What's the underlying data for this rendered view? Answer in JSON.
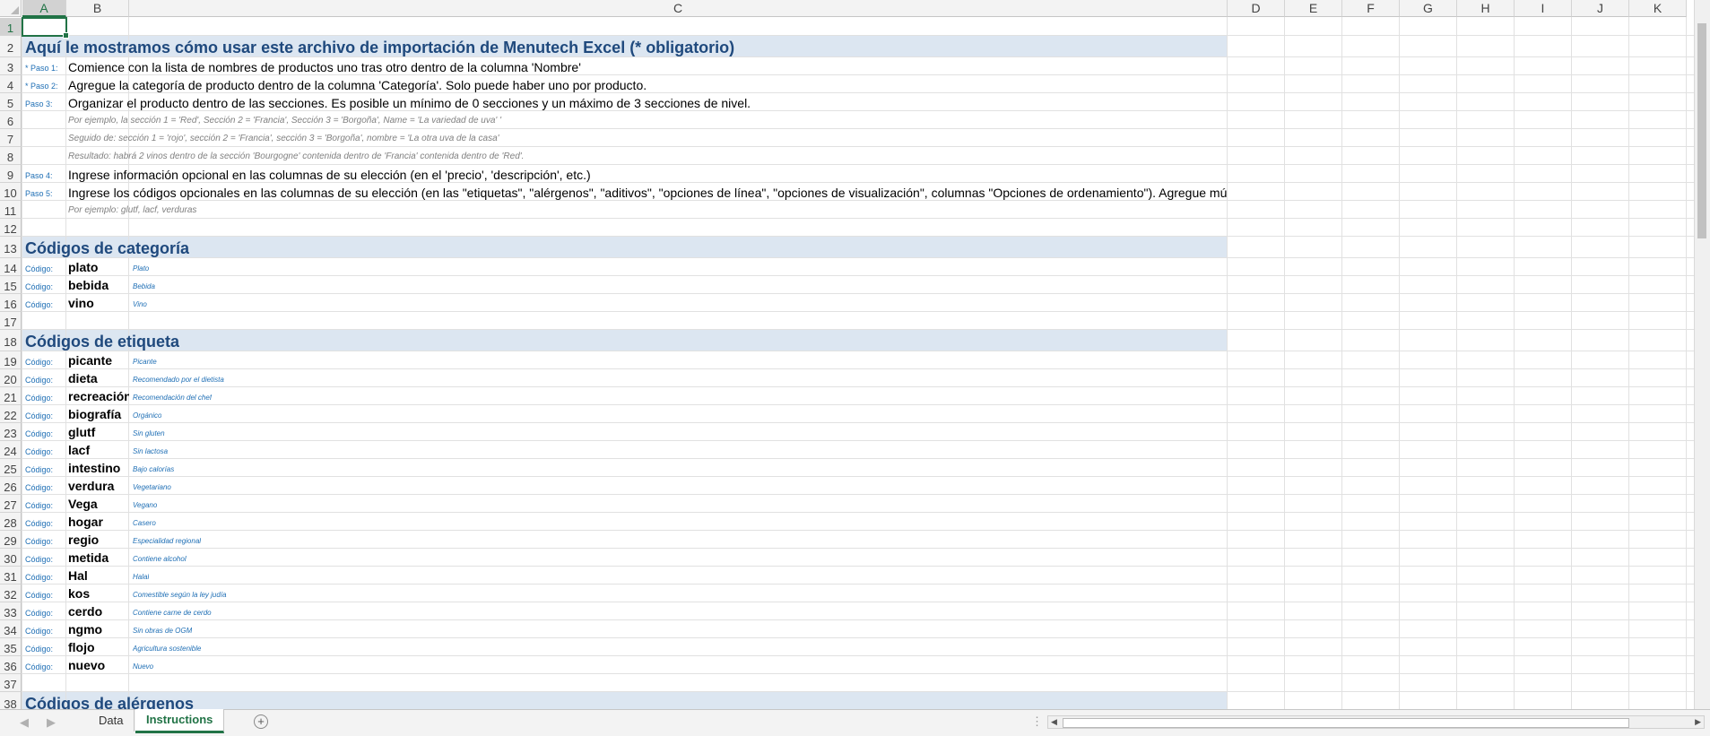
{
  "columns": [
    "A",
    "B",
    "C",
    "D",
    "E",
    "F",
    "G",
    "H",
    "I",
    "J",
    "K"
  ],
  "selected_cell": "A1",
  "rows": [
    {
      "n": "1",
      "type": "empty"
    },
    {
      "n": "2",
      "type": "title",
      "c1": "Aquí le mostramos cómo usar este archivo de importación de Menutech Excel (* obligatorio)"
    },
    {
      "n": "3",
      "type": "step",
      "a": "* Paso 1:",
      "b": "Comience con la lista de nombres de productos uno tras otro dentro de la columna 'Nombre'"
    },
    {
      "n": "4",
      "type": "step",
      "a": "* Paso 2:",
      "b": "Agregue la categoría de producto dentro de la columna 'Categoría'. Solo puede haber uno por producto."
    },
    {
      "n": "5",
      "type": "step",
      "a": "Paso 3:",
      "b": "Organizar el producto dentro de las secciones. Es posible un mínimo de 0 secciones y un máximo de 3 secciones de nivel."
    },
    {
      "n": "6",
      "type": "example",
      "b": "Por ejemplo, la sección 1 = 'Red', Sección 2 = 'Francia', Sección 3 = 'Borgoña', Name = 'La variedad de uva' '"
    },
    {
      "n": "7",
      "type": "example",
      "b": "Seguido de: sección 1 = 'rojo', sección 2 = 'Francia', sección 3 = 'Borgoña', nombre = 'La otra uva de la casa'"
    },
    {
      "n": "8",
      "type": "example",
      "b": "Resultado: habrá 2 vinos dentro de la sección 'Bourgogne' contenida dentro de 'Francia' contenida dentro de 'Red'."
    },
    {
      "n": "9",
      "type": "step",
      "a": "Paso 4:",
      "b": "Ingrese información opcional en las columnas de su elección (en el 'precio', 'descripción', etc.)"
    },
    {
      "n": "10",
      "type": "step",
      "a": "Paso 5:",
      "b": "Ingrese los códigos opcionales en las columnas de su elección (en las \"etiquetas\", \"alérgenos\", \"aditivos\", \"opciones de línea\", \"opciones de visualización\", columnas \"Opciones de ordenamiento\"). Agregue múltiples códigos separados por comas."
    },
    {
      "n": "11",
      "type": "example",
      "b": "Por ejemplo: glutf, lacf, verduras"
    },
    {
      "n": "12",
      "type": "empty"
    },
    {
      "n": "13",
      "type": "title",
      "c1": "Códigos de categoría"
    },
    {
      "n": "14",
      "type": "code",
      "a": "Código:",
      "b": "plato",
      "c": "Plato"
    },
    {
      "n": "15",
      "type": "code",
      "a": "Código:",
      "b": "bebida",
      "c": "Bebida"
    },
    {
      "n": "16",
      "type": "code",
      "a": "Código:",
      "b": "vino",
      "c": "Vino"
    },
    {
      "n": "17",
      "type": "empty"
    },
    {
      "n": "18",
      "type": "title",
      "c1": "Códigos de etiqueta"
    },
    {
      "n": "19",
      "type": "code",
      "a": "Código:",
      "b": "picante",
      "c": "Picante"
    },
    {
      "n": "20",
      "type": "code",
      "a": "Código:",
      "b": "dieta",
      "c": "Recomendado por el dietista"
    },
    {
      "n": "21",
      "type": "code",
      "a": "Código:",
      "b": "recreación",
      "c": "Recomendación del chef"
    },
    {
      "n": "22",
      "type": "code",
      "a": "Código:",
      "b": "biografía",
      "c": "Orgánico"
    },
    {
      "n": "23",
      "type": "code",
      "a": "Código:",
      "b": "glutf",
      "c": "Sin gluten"
    },
    {
      "n": "24",
      "type": "code",
      "a": "Código:",
      "b": "lacf",
      "c": "Sin lactosa"
    },
    {
      "n": "25",
      "type": "code",
      "a": "Código:",
      "b": "intestino",
      "c": "Bajo calorías"
    },
    {
      "n": "26",
      "type": "code",
      "a": "Código:",
      "b": "verdura",
      "c": "Vegetariano"
    },
    {
      "n": "27",
      "type": "code",
      "a": "Código:",
      "b": "Vega",
      "c": "Vegano"
    },
    {
      "n": "28",
      "type": "code",
      "a": "Código:",
      "b": "hogar",
      "c": "Casero"
    },
    {
      "n": "29",
      "type": "code",
      "a": "Código:",
      "b": "regio",
      "c": "Especialidad regional"
    },
    {
      "n": "30",
      "type": "code",
      "a": "Código:",
      "b": "metida",
      "c": "Contiene alcohol"
    },
    {
      "n": "31",
      "type": "code",
      "a": "Código:",
      "b": "Hal",
      "c": "Halal"
    },
    {
      "n": "32",
      "type": "code",
      "a": "Código:",
      "b": "kos",
      "c": "Comestible según la ley judía"
    },
    {
      "n": "33",
      "type": "code",
      "a": "Código:",
      "b": "cerdo",
      "c": "Contiene carne de cerdo"
    },
    {
      "n": "34",
      "type": "code",
      "a": "Código:",
      "b": "ngmo",
      "c": "Sin obras de OGM"
    },
    {
      "n": "35",
      "type": "code",
      "a": "Código:",
      "b": "flojo",
      "c": "Agricultura sostenible"
    },
    {
      "n": "36",
      "type": "code",
      "a": "Código:",
      "b": "nuevo",
      "c": "Nuevo"
    },
    {
      "n": "37",
      "type": "empty"
    },
    {
      "n": "38",
      "type": "title",
      "c1": "Códigos de alérgenos"
    }
  ],
  "tabs": [
    {
      "label": "Data",
      "active": false
    },
    {
      "label": "Instructions",
      "active": true
    }
  ],
  "icons": {
    "prev_sheet": "triangle-left-icon",
    "next_sheet": "triangle-right-icon",
    "add_sheet": "plus-circle-icon",
    "options": "vertical-dots-icon",
    "scroll_left": "triangle-left-icon",
    "scroll_right": "triangle-right-icon"
  },
  "colors": {
    "accent": "#217346",
    "title_text": "#1f497d",
    "title_band": "#dce6f1",
    "code_label": "#1f6fb5"
  }
}
